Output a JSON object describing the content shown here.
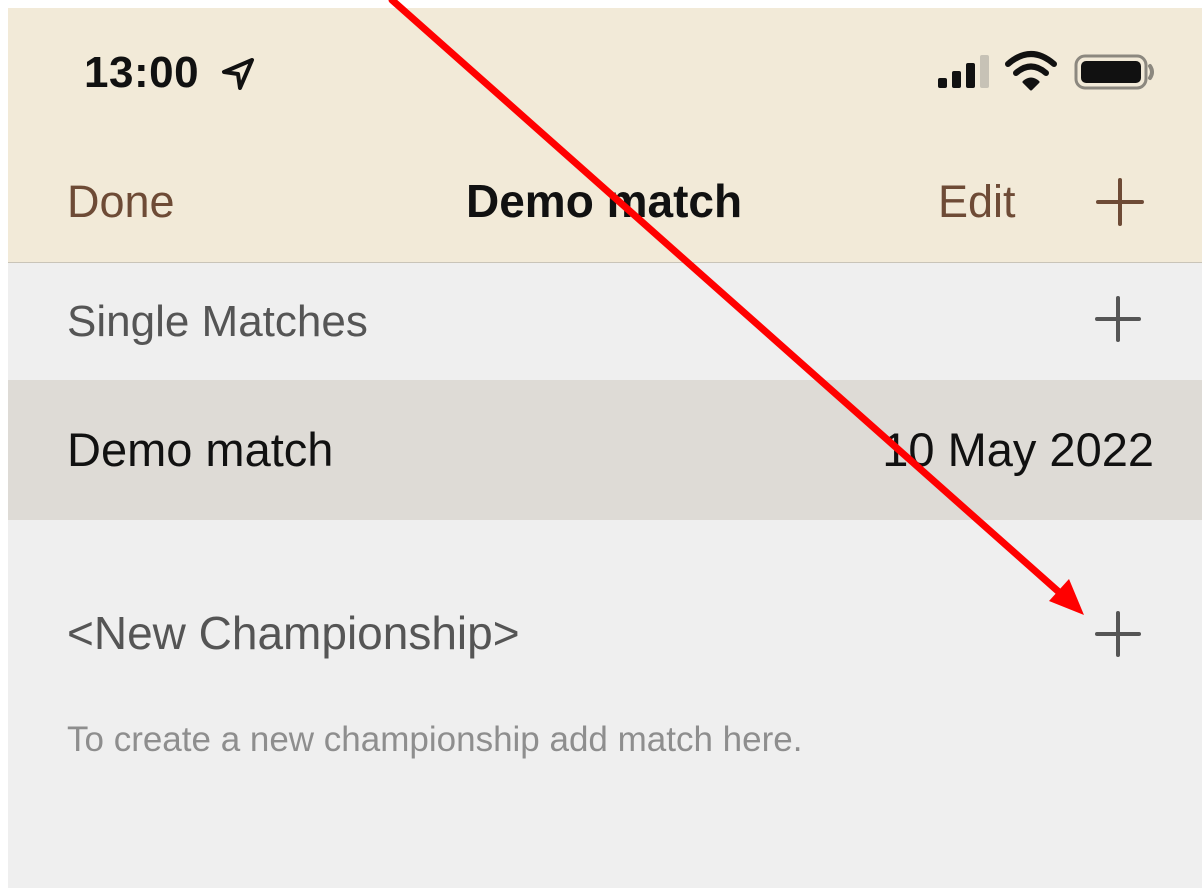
{
  "status_bar": {
    "time": "13:00",
    "location_icon": "location-arrow-icon",
    "signal_icon": "cellular-signal-icon",
    "wifi_icon": "wifi-icon",
    "battery_icon": "battery-icon"
  },
  "nav": {
    "done_label": "Done",
    "title": "Demo match",
    "edit_label": "Edit",
    "add_icon": "plus-icon"
  },
  "single_matches": {
    "header": "Single Matches",
    "add_icon": "plus-icon",
    "rows": [
      {
        "name": "Demo match",
        "date": "10 May 2022"
      }
    ]
  },
  "championship": {
    "label": "<New Championship>",
    "add_icon": "plus-icon",
    "hint": "To create a new championship add match here."
  },
  "colors": {
    "nav_background": "#f2ead8",
    "nav_accent": "#6e4b36",
    "list_background": "#efefef",
    "selected_row": "#dedbd6",
    "annotation_arrow": "#ff0000"
  }
}
